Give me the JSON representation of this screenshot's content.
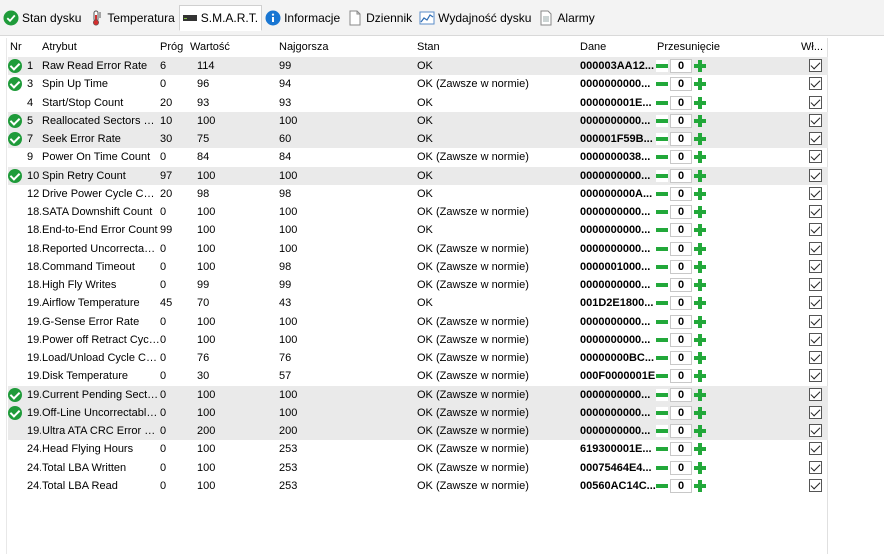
{
  "tabs": [
    {
      "label": "Stan dysku",
      "icon": "check-circle-icon"
    },
    {
      "label": "Temperatura",
      "icon": "thermometer-icon"
    },
    {
      "label": "S.M.A.R.T.",
      "icon": "disk-drive-icon"
    },
    {
      "label": "Informacje",
      "icon": "info-icon"
    },
    {
      "label": "Dziennik",
      "icon": "document-icon"
    },
    {
      "label": "Wydajność dysku",
      "icon": "performance-chart-icon"
    },
    {
      "label": "Alarmy",
      "icon": "alarm-document-icon"
    }
  ],
  "active_tab": "S.M.A.R.T.",
  "columns": {
    "nr": "Nr",
    "attr": "Atrybut",
    "prog": "Próg",
    "val": "Wartość",
    "worst": "Najgorsza",
    "state": "Stan",
    "data": "Dane",
    "shift": "Przesunięcie",
    "enabled": "Wł..."
  },
  "colors": {
    "ok_green": "#1f9b3a",
    "button_green": "#22a83a",
    "highlight_row": "#eaeaea"
  },
  "rows": [
    {
      "ok": true,
      "hl": true,
      "nr": "1",
      "attr": "Raw Read Error Rate",
      "prog": "6",
      "val": "114",
      "worst": "99",
      "state": "OK",
      "data": "000003AA12...",
      "shift": "0",
      "enabled": true
    },
    {
      "ok": true,
      "hl": false,
      "nr": "3",
      "attr": "Spin Up Time",
      "prog": "0",
      "val": "96",
      "worst": "94",
      "state": "OK (Zawsze w normie)",
      "data": "0000000000...",
      "shift": "0",
      "enabled": true
    },
    {
      "ok": false,
      "hl": false,
      "nr": "4",
      "attr": "Start/Stop Count",
      "prog": "20",
      "val": "93",
      "worst": "93",
      "state": "OK",
      "data": "000000001E...",
      "shift": "0",
      "enabled": true
    },
    {
      "ok": true,
      "hl": true,
      "nr": "5",
      "attr": "Reallocated Sectors Co...",
      "prog": "10",
      "val": "100",
      "worst": "100",
      "state": "OK",
      "data": "0000000000...",
      "shift": "0",
      "enabled": true
    },
    {
      "ok": true,
      "hl": true,
      "nr": "7",
      "attr": "Seek Error Rate",
      "prog": "30",
      "val": "75",
      "worst": "60",
      "state": "OK",
      "data": "000001F59B...",
      "shift": "0",
      "enabled": true
    },
    {
      "ok": false,
      "hl": false,
      "nr": "9",
      "attr": "Power On Time Count",
      "prog": "0",
      "val": "84",
      "worst": "84",
      "state": "OK (Zawsze w normie)",
      "data": "0000000038...",
      "shift": "0",
      "enabled": true
    },
    {
      "ok": true,
      "hl": true,
      "nr": "10",
      "attr": "Spin Retry Count",
      "prog": "97",
      "val": "100",
      "worst": "100",
      "state": "OK",
      "data": "0000000000...",
      "shift": "0",
      "enabled": true
    },
    {
      "ok": false,
      "hl": false,
      "nr": "12",
      "attr": "Drive Power Cycle Cou...",
      "prog": "20",
      "val": "98",
      "worst": "98",
      "state": "OK",
      "data": "000000000A...",
      "shift": "0",
      "enabled": true
    },
    {
      "ok": false,
      "hl": false,
      "nr": "18...",
      "attr": "SATA Downshift Count",
      "prog": "0",
      "val": "100",
      "worst": "100",
      "state": "OK (Zawsze w normie)",
      "data": "0000000000...",
      "shift": "0",
      "enabled": true
    },
    {
      "ok": false,
      "hl": false,
      "nr": "18...",
      "attr": "End-to-End Error Count",
      "prog": "99",
      "val": "100",
      "worst": "100",
      "state": "OK",
      "data": "0000000000...",
      "shift": "0",
      "enabled": true
    },
    {
      "ok": false,
      "hl": false,
      "nr": "18...",
      "attr": "Reported Uncorrectabl...",
      "prog": "0",
      "val": "100",
      "worst": "100",
      "state": "OK (Zawsze w normie)",
      "data": "0000000000...",
      "shift": "0",
      "enabled": true
    },
    {
      "ok": false,
      "hl": false,
      "nr": "18...",
      "attr": "Command Timeout",
      "prog": "0",
      "val": "100",
      "worst": "98",
      "state": "OK (Zawsze w normie)",
      "data": "0000001000...",
      "shift": "0",
      "enabled": true
    },
    {
      "ok": false,
      "hl": false,
      "nr": "18...",
      "attr": "High Fly Writes",
      "prog": "0",
      "val": "99",
      "worst": "99",
      "state": "OK (Zawsze w normie)",
      "data": "0000000000...",
      "shift": "0",
      "enabled": true
    },
    {
      "ok": false,
      "hl": false,
      "nr": "19...",
      "attr": "Airflow Temperature",
      "prog": "45",
      "val": "70",
      "worst": "43",
      "state": "OK",
      "data": "001D2E1800...",
      "shift": "0",
      "enabled": true
    },
    {
      "ok": false,
      "hl": false,
      "nr": "19...",
      "attr": "G-Sense Error Rate",
      "prog": "0",
      "val": "100",
      "worst": "100",
      "state": "OK (Zawsze w normie)",
      "data": "0000000000...",
      "shift": "0",
      "enabled": true
    },
    {
      "ok": false,
      "hl": false,
      "nr": "19...",
      "attr": "Power off Retract Cycl...",
      "prog": "0",
      "val": "100",
      "worst": "100",
      "state": "OK (Zawsze w normie)",
      "data": "0000000000...",
      "shift": "0",
      "enabled": true
    },
    {
      "ok": false,
      "hl": false,
      "nr": "19...",
      "attr": "Load/Unload Cycle Co...",
      "prog": "0",
      "val": "76",
      "worst": "76",
      "state": "OK (Zawsze w normie)",
      "data": "00000000BC...",
      "shift": "0",
      "enabled": true
    },
    {
      "ok": false,
      "hl": false,
      "nr": "19...",
      "attr": "Disk Temperature",
      "prog": "0",
      "val": "30",
      "worst": "57",
      "state": "OK (Zawsze w normie)",
      "data": "000F0000001E",
      "shift": "0",
      "enabled": true
    },
    {
      "ok": true,
      "hl": true,
      "nr": "19...",
      "attr": "Current Pending Secto...",
      "prog": "0",
      "val": "100",
      "worst": "100",
      "state": "OK (Zawsze w normie)",
      "data": "0000000000...",
      "shift": "0",
      "enabled": true
    },
    {
      "ok": true,
      "hl": true,
      "nr": "19...",
      "attr": "Off-Line Uncorrectable...",
      "prog": "0",
      "val": "100",
      "worst": "100",
      "state": "OK (Zawsze w normie)",
      "data": "0000000000...",
      "shift": "0",
      "enabled": true
    },
    {
      "ok": false,
      "hl": true,
      "nr": "19...",
      "attr": "Ultra ATA CRC Error C...",
      "prog": "0",
      "val": "200",
      "worst": "200",
      "state": "OK (Zawsze w normie)",
      "data": "0000000000...",
      "shift": "0",
      "enabled": true
    },
    {
      "ok": false,
      "hl": false,
      "nr": "24...",
      "attr": "Head Flying Hours",
      "prog": "0",
      "val": "100",
      "worst": "253",
      "state": "OK (Zawsze w normie)",
      "data": "619300001E...",
      "shift": "0",
      "enabled": true
    },
    {
      "ok": false,
      "hl": false,
      "nr": "24...",
      "attr": "Total LBA Written",
      "prog": "0",
      "val": "100",
      "worst": "253",
      "state": "OK (Zawsze w normie)",
      "data": "00075464E4...",
      "shift": "0",
      "enabled": true
    },
    {
      "ok": false,
      "hl": false,
      "nr": "24...",
      "attr": "Total LBA Read",
      "prog": "0",
      "val": "100",
      "worst": "253",
      "state": "OK (Zawsze w normie)",
      "data": "00560AC14C...",
      "shift": "0",
      "enabled": true
    }
  ]
}
